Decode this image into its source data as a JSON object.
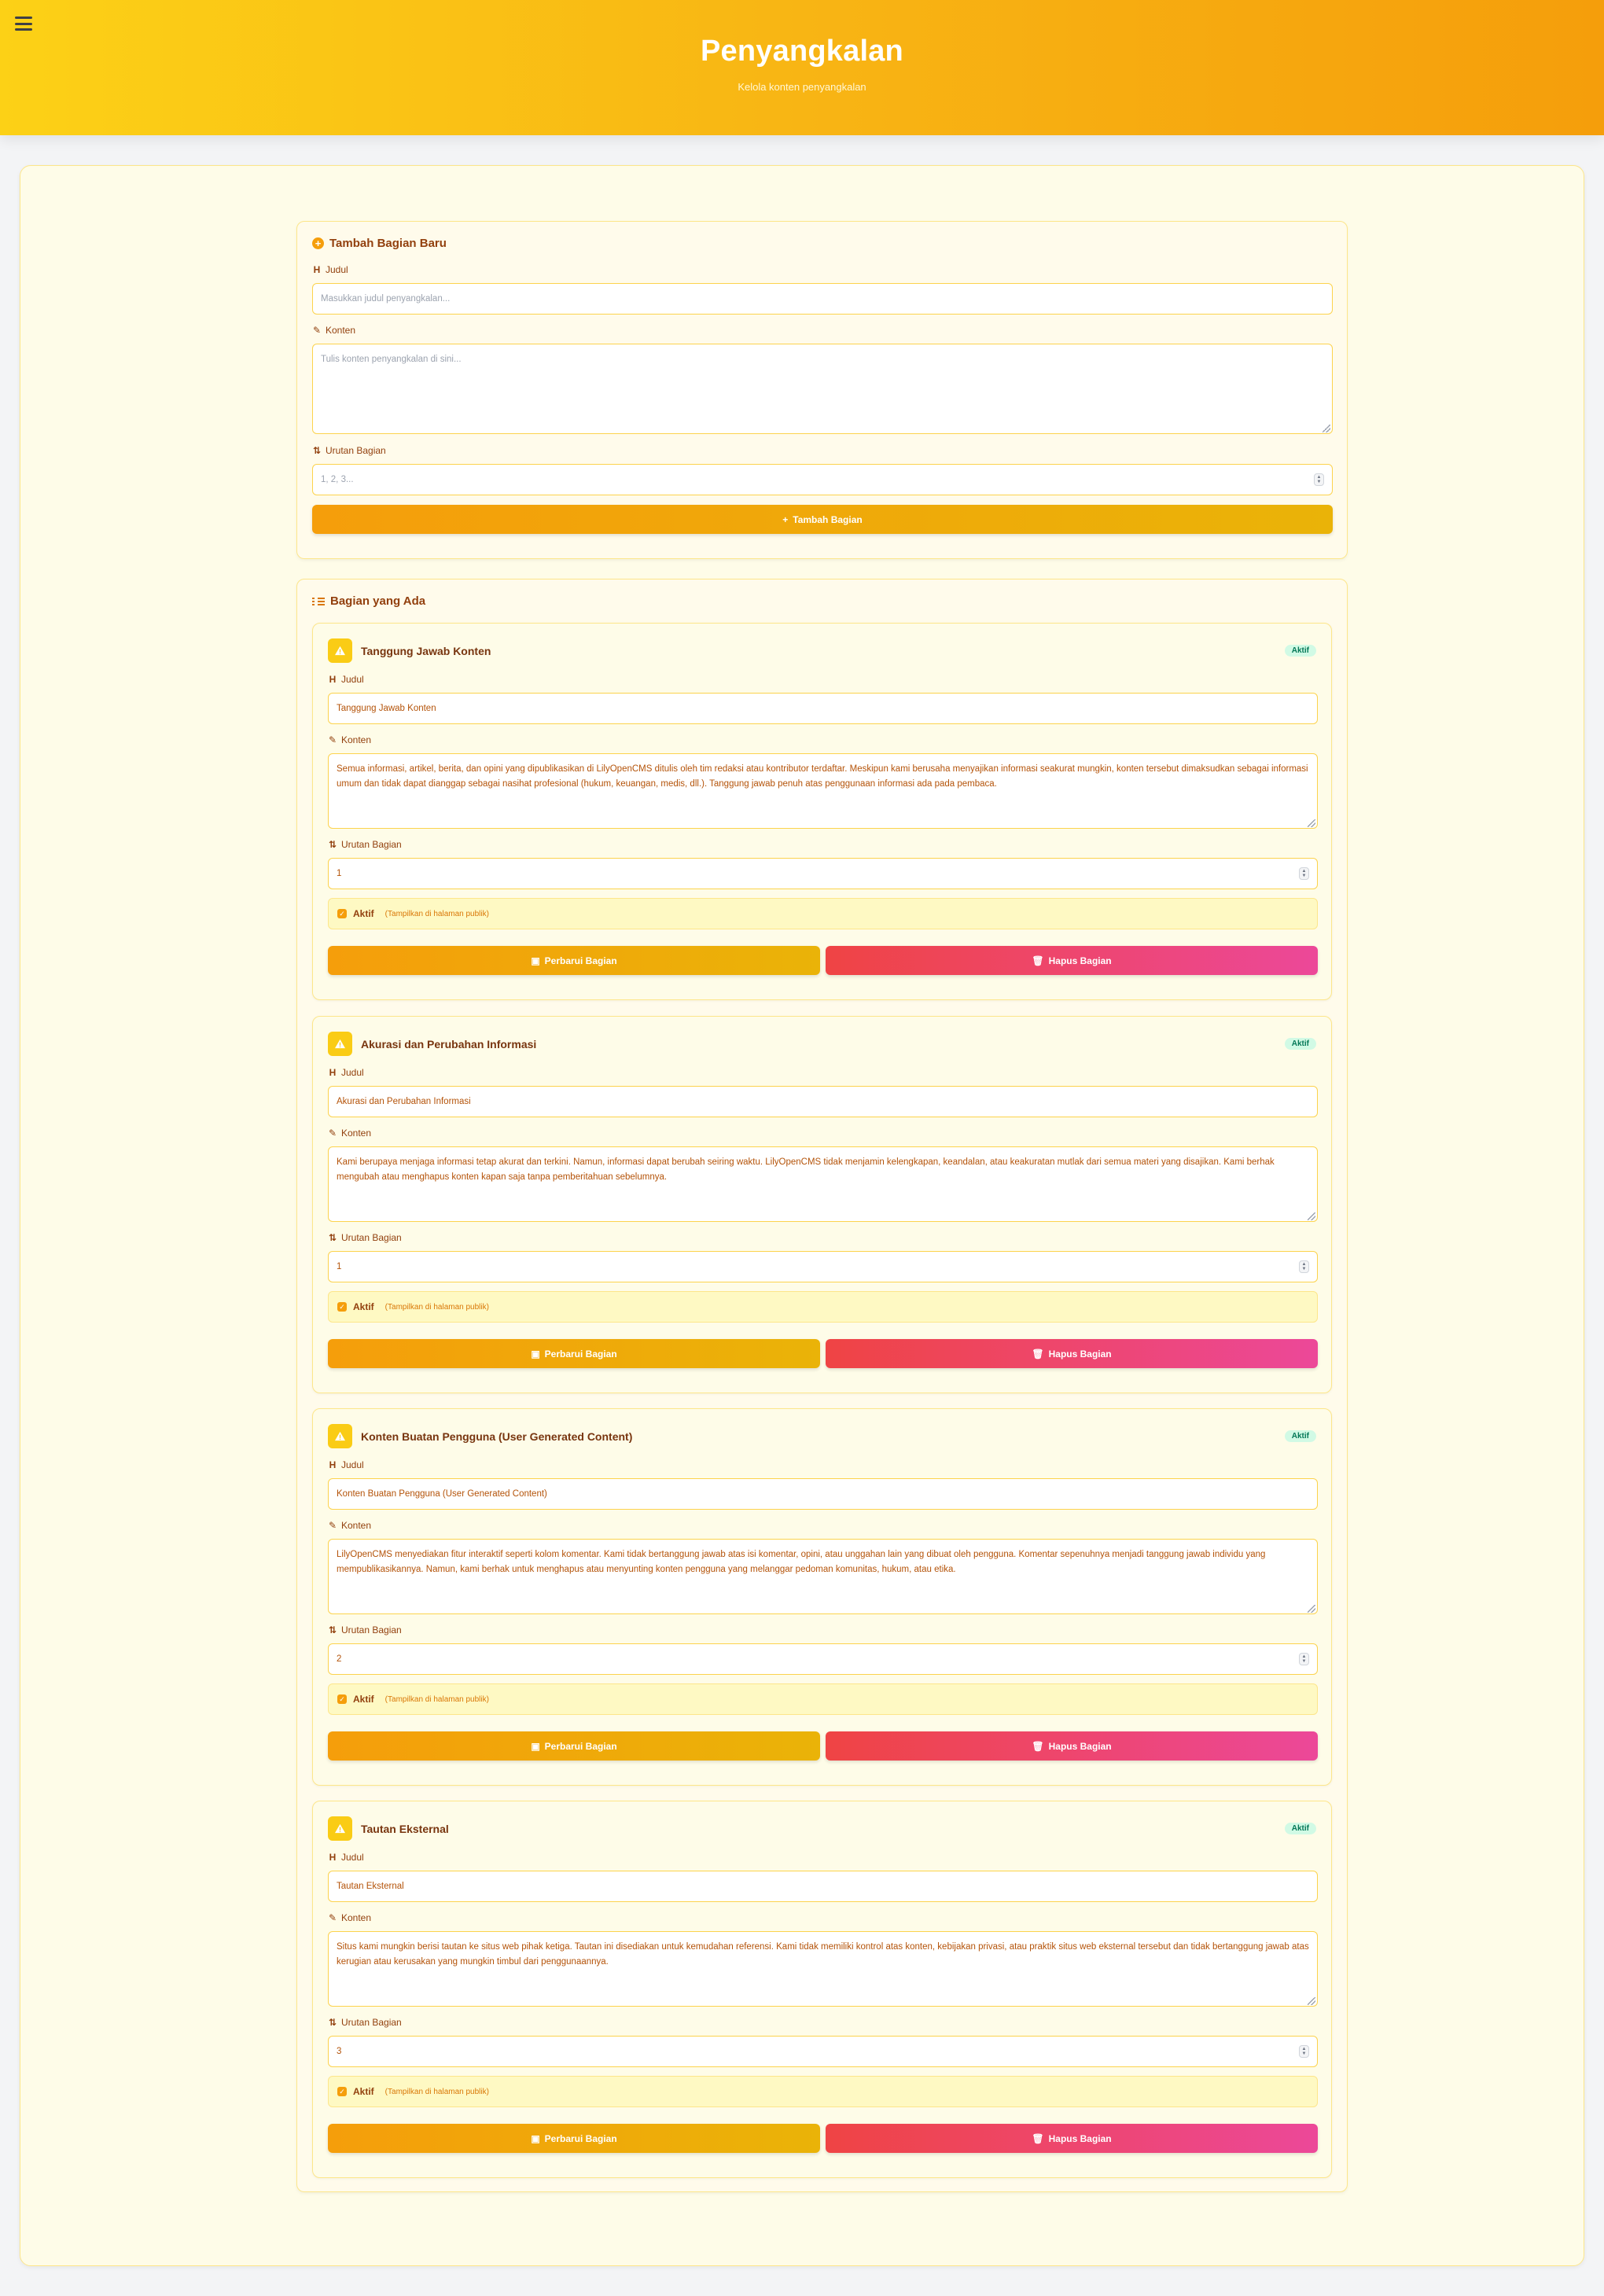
{
  "header": {
    "title": "Penyangkalan",
    "subtitle": "Kelola konten penyangkalan"
  },
  "new_section": {
    "title": "Tambah Bagian Baru",
    "title_label": "Judul",
    "title_placeholder": "Masukkan judul penyangkalan...",
    "content_label": "Konten",
    "content_placeholder": "Tulis konten penyangkalan di sini...",
    "order_label": "Urutan Bagian",
    "order_placeholder": "1, 2, 3...",
    "submit_label": "Tambah Bagian"
  },
  "existing": {
    "title": "Bagian yang Ada",
    "labels": {
      "title": "Judul",
      "content": "Konten",
      "order": "Urutan Bagian",
      "active": "Aktif",
      "active_hint": "(Tampilkan di halaman publik)",
      "update": "Perbarui Bagian",
      "delete": "Hapus Bagian",
      "badge": "Aktif"
    },
    "sections": [
      {
        "title": "Tanggung Jawab Konten",
        "content": "Semua informasi, artikel, berita, dan opini yang dipublikasikan di LilyOpenCMS ditulis oleh tim redaksi atau kontributor terdaftar. Meskipun kami berusaha menyajikan informasi seakurat mungkin, konten tersebut dimaksudkan sebagai informasi umum dan tidak dapat dianggap sebagai nasihat profesional (hukum, keuangan, medis, dll.). Tanggung jawab penuh atas penggunaan informasi ada pada pembaca.",
        "order": "1",
        "active": true
      },
      {
        "title": "Akurasi dan Perubahan Informasi",
        "content": "Kami berupaya menjaga informasi tetap akurat dan terkini. Namun, informasi dapat berubah seiring waktu. LilyOpenCMS tidak menjamin kelengkapan, keandalan, atau keakuratan mutlak dari semua materi yang disajikan. Kami berhak mengubah atau menghapus konten kapan saja tanpa pemberitahuan sebelumnya.",
        "order": "1",
        "active": true
      },
      {
        "title": "Konten Buatan Pengguna (User Generated Content)",
        "content": "LilyOpenCMS menyediakan fitur interaktif seperti kolom komentar. Kami tidak bertanggung jawab atas isi komentar, opini, atau unggahan lain yang dibuat oleh pengguna. Komentar sepenuhnya menjadi tanggung jawab individu yang mempublikasikannya. Namun, kami berhak untuk menghapus atau menyunting konten pengguna yang melanggar pedoman komunitas, hukum, atau etika.",
        "order": "2",
        "active": true
      },
      {
        "title": "Tautan Eksternal",
        "content": "Situs kami mungkin berisi tautan ke situs web pihak ketiga. Tautan ini disediakan untuk kemudahan referensi. Kami tidak memiliki kontrol atas konten, kebijakan privasi, atau praktik situs web eksternal tersebut dan tidak bertanggung jawab atas kerugian atau kerusakan yang mungkin timbul dari penggunaannya.",
        "order": "3",
        "active": true
      }
    ]
  },
  "colors": {
    "header_start": "#fcd116",
    "header_end": "#f59e0b",
    "amber_button": "#f59e0b",
    "rose_button": "#ef4444",
    "badge_bg": "#d1fae5",
    "badge_text": "#047857"
  },
  "icons": {
    "menu": "hamburger-icon",
    "add": "plus-circle-icon",
    "heading": "heading-icon",
    "edit": "edit-icon",
    "sort": "sort-icon",
    "list": "list-icon",
    "warning": "warning-icon",
    "save": "save-icon",
    "trash": "trash-icon"
  }
}
